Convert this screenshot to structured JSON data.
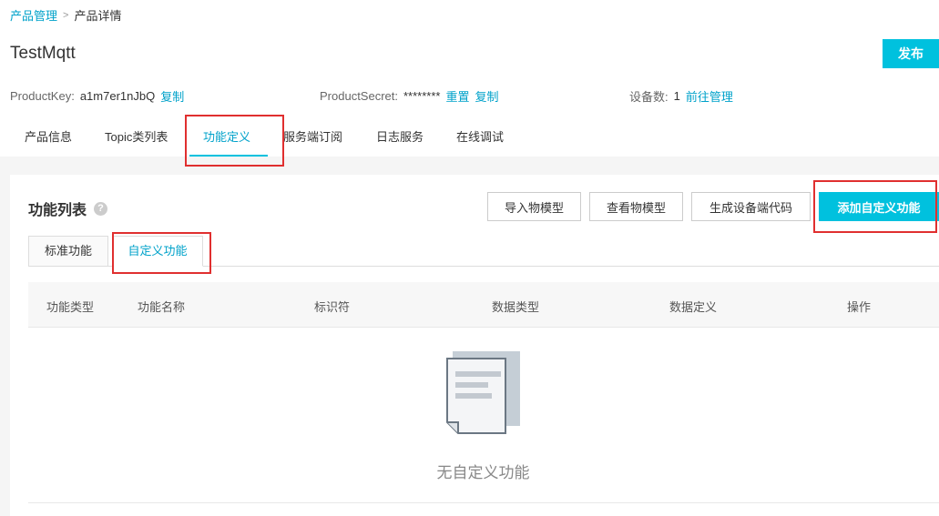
{
  "breadcrumb": {
    "parent": "产品管理",
    "separator": ">",
    "current": "产品详情"
  },
  "product": {
    "name": "TestMqtt",
    "publish_label": "发布",
    "product_key_label": "ProductKey:",
    "product_key_value": "a1m7er1nJbQ",
    "copy_label": "复制",
    "product_secret_label": "ProductSecret:",
    "product_secret_value": "********",
    "reset_label": "重置",
    "copy_label_2": "复制",
    "device_count_label": "设备数:",
    "device_count_value": "1",
    "goto_manage_label": "前往管理"
  },
  "tabs": [
    {
      "label": "产品信息"
    },
    {
      "label": "Topic类列表"
    },
    {
      "label": "功能定义",
      "active": true
    },
    {
      "label": "服务端订阅"
    },
    {
      "label": "日志服务"
    },
    {
      "label": "在线调试"
    }
  ],
  "function_list": {
    "title": "功能列表",
    "help_icon": "?",
    "buttons": {
      "import_model": "导入物模型",
      "view_model": "查看物模型",
      "generate_code": "生成设备端代码",
      "add_custom": "添加自定义功能"
    },
    "subtabs": [
      {
        "label": "标准功能"
      },
      {
        "label": "自定义功能",
        "active": true
      }
    ],
    "columns": [
      "功能类型",
      "功能名称",
      "标识符",
      "数据类型",
      "数据定义",
      "操作"
    ],
    "empty_text": "无自定义功能"
  },
  "colors": {
    "accent": "#00c1de",
    "link": "#00a2ca",
    "highlight_box": "#e02f2f"
  }
}
